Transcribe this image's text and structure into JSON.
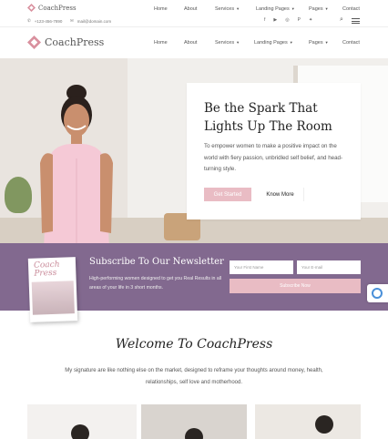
{
  "brand": {
    "name": "CoachPress",
    "color": "#d9909e"
  },
  "colors": {
    "accent_pink": "#e9bcc4",
    "newsletter_bg": "#82698f"
  },
  "mini_header": {
    "phone": "+123-456-7890",
    "email": "mail@domain.com",
    "nav": [
      "Home",
      "About",
      "Services",
      "Landing Pages",
      "Pages",
      "Contact"
    ],
    "socials": [
      "facebook-icon",
      "youtube-icon",
      "instagram-icon",
      "pinterest-icon",
      "twitter-icon"
    ]
  },
  "header": {
    "nav": [
      "Home",
      "About",
      "Services",
      "Landing Pages",
      "Pages",
      "Contact"
    ]
  },
  "hero": {
    "title": "Be the Spark That Lights Up The Room",
    "text": "To empower women to make a positive impact on the world with fiery passion, unbridled self belief, and head-turning style.",
    "primary_button": "Get Started",
    "secondary_button": "Know More"
  },
  "newsletter": {
    "book_title_1": "Coach",
    "book_title_2": "Press",
    "title": "Subscribe To Our Newsletter",
    "text": "High-performing women designed to get you Real Results in all areas of your life in 3 short months.",
    "first_name_placeholder": "Your First Name",
    "email_placeholder": "Your E-mail",
    "button": "Subscribe Now"
  },
  "welcome": {
    "title": "Welcome To CoachPress",
    "text": "My signature are like nothing else on the market, designed to reframe your thoughts around money, health, relationships, self love and motherhood."
  }
}
